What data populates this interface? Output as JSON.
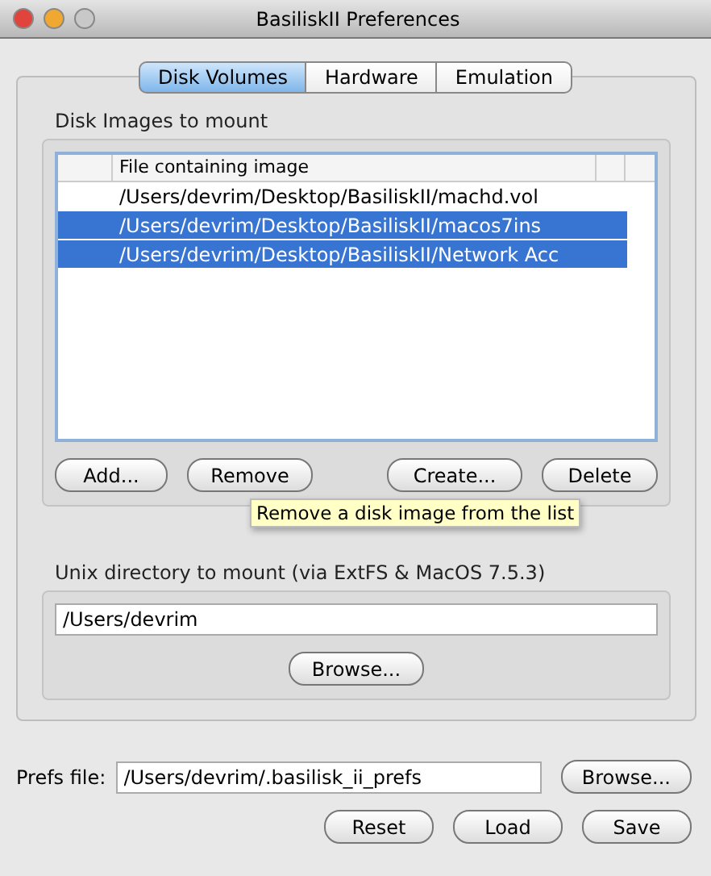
{
  "window": {
    "title": "BasiliskII Preferences",
    "controls": [
      {
        "color": "#e0443c"
      },
      {
        "color": "#f0a830"
      },
      {
        "color": "#c8c8c8"
      }
    ]
  },
  "tabs": [
    {
      "label": "Disk Volumes",
      "selected": true
    },
    {
      "label": "Hardware",
      "selected": false
    },
    {
      "label": "Emulation",
      "selected": false
    }
  ],
  "disk_images": {
    "title": "Disk Images to mount",
    "table": {
      "columns": [
        "File containing image"
      ],
      "rows": [
        {
          "path": "/Users/devrim/Desktop/BasiliskII/machd.vol",
          "selected": false
        },
        {
          "path": "/Users/devrim/Desktop/BasiliskII/macos7ins",
          "selected": true
        },
        {
          "path": "/Users/devrim/Desktop/BasiliskII/Network Acc",
          "selected": true
        }
      ]
    },
    "buttons": [
      "Add...",
      "Remove",
      "Create...",
      "Delete"
    ],
    "tooltip": "Remove a disk image from the list"
  },
  "unix_directory": {
    "title": "Unix directory to mount (via ExtFS & MacOS 7.5.3)",
    "value": "/Users/devrim",
    "button": "Browse..."
  },
  "prefs_file": {
    "label": "Prefs file:",
    "value": "/Users/devrim/.basilisk_ii_prefs",
    "button": "Browse..."
  },
  "footer_buttons": [
    "Reset",
    "Load",
    "Save"
  ]
}
